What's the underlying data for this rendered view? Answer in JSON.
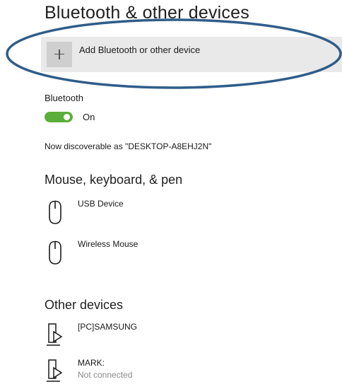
{
  "page": {
    "title": "Bluetooth & other devices"
  },
  "add_device": {
    "label": "Add Bluetooth or other device",
    "icon": "plus-icon"
  },
  "bluetooth": {
    "label": "Bluetooth",
    "toggle_state": "On",
    "toggle_on": true,
    "accent_color": "#5aae3a",
    "discoverable_text": "Now discoverable as \"DESKTOP-A8EHJ2N\""
  },
  "mouse_keyboard_pen": {
    "heading": "Mouse, keyboard, & pen",
    "devices": [
      {
        "name": "USB Device",
        "icon": "mouse-icon"
      },
      {
        "name": "Wireless Mouse",
        "icon": "mouse-icon"
      }
    ]
  },
  "other_devices": {
    "heading": "Other devices",
    "devices": [
      {
        "name": "[PC]SAMSUNG",
        "icon": "media-device-icon",
        "status": ""
      },
      {
        "name": "MARK:",
        "icon": "media-device-icon",
        "status": "Not connected"
      }
    ]
  },
  "annotation": {
    "color": "#2f5d8a"
  }
}
